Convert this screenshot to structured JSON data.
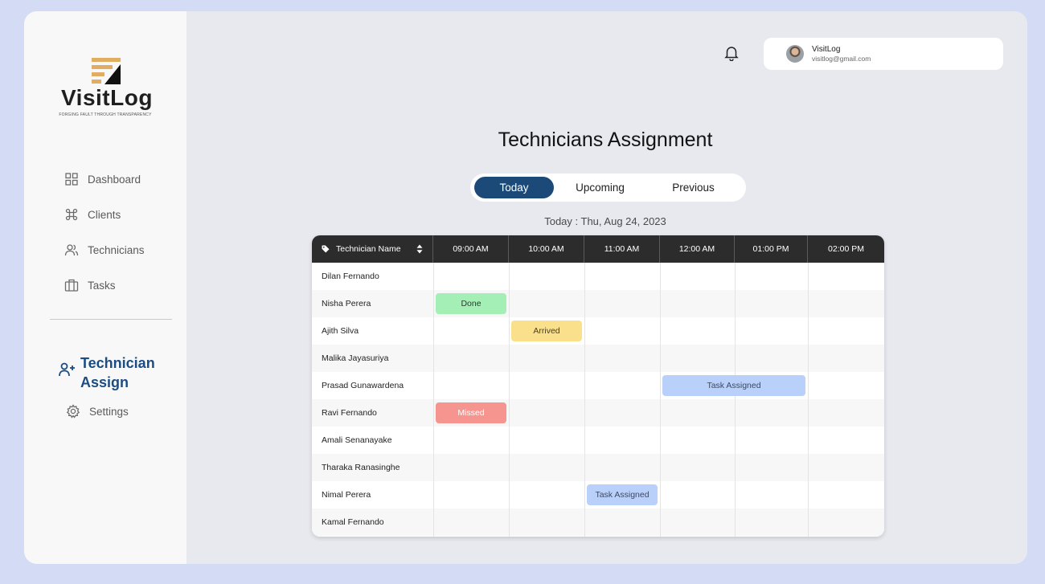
{
  "app": {
    "name": "VisitLog",
    "tagline": "FORGING FAULT THROUGH TRANSPARENCY"
  },
  "sidebar": {
    "items": [
      {
        "label": "Dashboard",
        "icon": "grid-icon"
      },
      {
        "label": "Clients",
        "icon": "command-icon"
      },
      {
        "label": "Technicians",
        "icon": "users-icon"
      },
      {
        "label": "Tasks",
        "icon": "briefcase-icon"
      }
    ],
    "active": {
      "label_line1": "Technician",
      "label_line2": "Assign",
      "icon": "user-plus-icon"
    },
    "settings": {
      "label": "Settings",
      "icon": "gear-icon"
    }
  },
  "header": {
    "notification_icon": "bell-icon",
    "user": {
      "name": "VisitLog",
      "email": "visitlog@gmail.com"
    }
  },
  "page": {
    "title": "Technicians Assignment",
    "tabs": [
      "Today",
      "Upcoming",
      "Previous"
    ],
    "active_tab": "Today",
    "date_line": "Today : Thu, Aug 24, 2023"
  },
  "table": {
    "name_header": "Technician Name",
    "time_columns": [
      "09:00 AM",
      "10:00 AM",
      "11:00 AM",
      "12:00 AM",
      "01:00 PM",
      "02:00 PM"
    ],
    "technicians": [
      "Dilan Fernando",
      "Nisha Perera",
      "Ajith Silva",
      "Malika Jayasuriya",
      "Prasad Gunawardena",
      "Ravi Fernando",
      "Amali Senanayake",
      "Tharaka Ranasinghe",
      "Nimal Perera",
      "Kamal Fernando"
    ],
    "assignments": [
      {
        "technician": "Nisha Perera",
        "start": "09:00 AM",
        "end": "09:00 AM",
        "status": "Done"
      },
      {
        "technician": "Ajith Silva",
        "start": "10:00 AM",
        "end": "10:00 AM",
        "status": "Arrived"
      },
      {
        "technician": "Prasad Gunawardena",
        "start": "12:00 AM",
        "end": "01:00 PM",
        "status": "Task Assigned"
      },
      {
        "technician": "Ravi Fernando",
        "start": "09:00 AM",
        "end": "09:00 AM",
        "status": "Missed"
      },
      {
        "technician": "Nimal Perera",
        "start": "11:00 AM",
        "end": "11:00 AM",
        "status": "Task Assigned"
      }
    ],
    "status_colors": {
      "Done": {
        "bg": "#a3efb6",
        "fg": "#2a3a2e"
      },
      "Arrived": {
        "bg": "#fae08a",
        "fg": "#4a4120"
      },
      "Task Assigned": {
        "bg": "#b9d0fb",
        "fg": "#3c4a63"
      },
      "Missed": {
        "bg": "#f6958f",
        "fg": "#ffffff"
      }
    }
  },
  "colors": {
    "primary": "#1b4a78",
    "header_dark": "#2c2c2c",
    "background": "#d4dcf5"
  }
}
